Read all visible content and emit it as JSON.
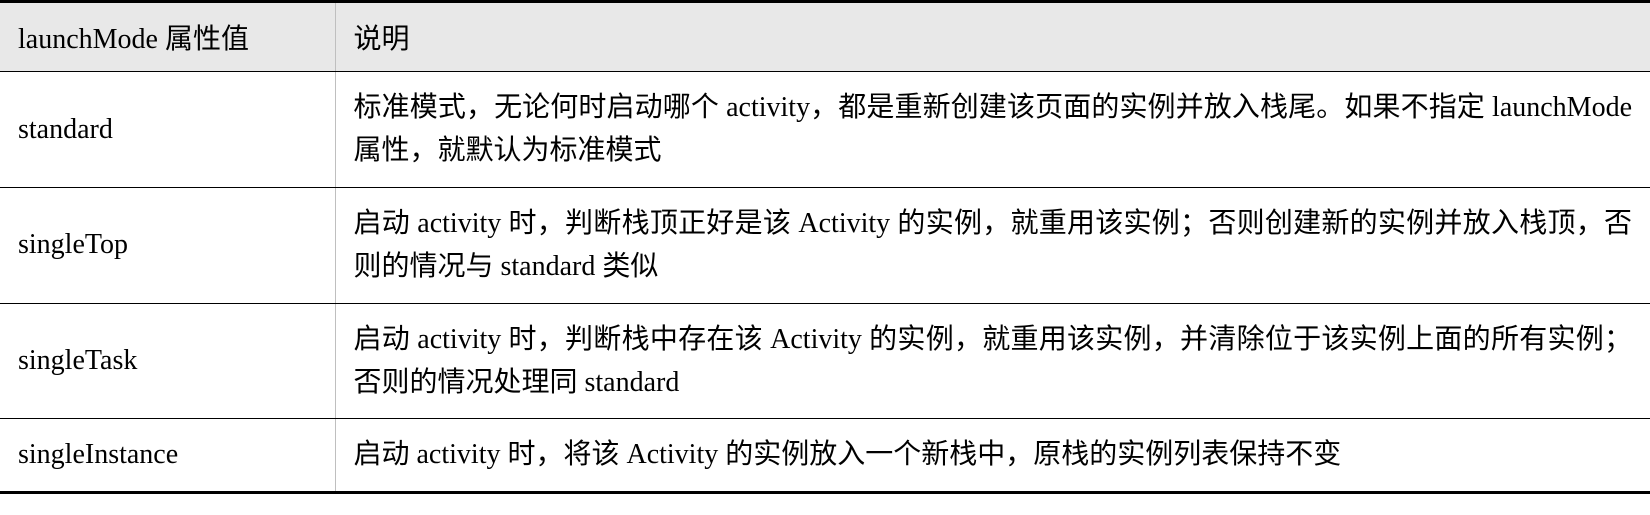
{
  "headers": {
    "col0": "launchMode 属性值",
    "col1": "说明"
  },
  "rows": [
    {
      "mode": "standard",
      "desc": "标准模式，无论何时启动哪个 activity，都是重新创建该页面的实例并放入栈尾。如果不指定 launchMode 属性，就默认为标准模式"
    },
    {
      "mode": "singleTop",
      "desc": "启动 activity 时，判断栈顶正好是该 Activity 的实例，就重用该实例；否则创建新的实例并放入栈顶，否则的情况与 standard 类似"
    },
    {
      "mode": "singleTask",
      "desc": "启动 activity 时，判断栈中存在该 Activity 的实例，就重用该实例，并清除位于该实例上面的所有实例；否则的情况处理同 standard"
    },
    {
      "mode": "singleInstance",
      "desc": "启动 activity 时，将该 Activity 的实例放入一个新栈中，原栈的实例列表保持不变"
    }
  ]
}
